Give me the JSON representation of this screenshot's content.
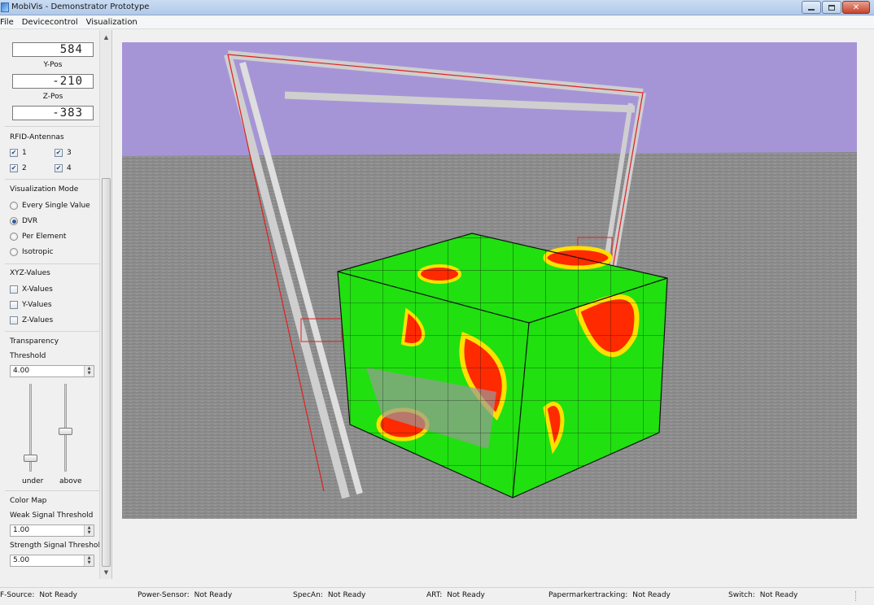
{
  "window": {
    "title": "MobiVis - Demonstrator Prototype",
    "controls": [
      "minimize",
      "maximize",
      "close"
    ],
    "close_glyph": "✕"
  },
  "menu": [
    "File",
    "Devicecontrol",
    "Visualization"
  ],
  "position": {
    "x_value": "584",
    "y_label": "Y-Pos",
    "y_value": "-210",
    "z_label": "Z-Pos",
    "z_value": "-383"
  },
  "rfid": {
    "title": "RFID-Antennas",
    "antennas": [
      {
        "label": "1",
        "checked": true
      },
      {
        "label": "3",
        "checked": true
      },
      {
        "label": "2",
        "checked": true
      },
      {
        "label": "4",
        "checked": true
      }
    ]
  },
  "vis_mode": {
    "title": "Visualization Mode",
    "options": [
      {
        "label": "Every Single  Value",
        "selected": false
      },
      {
        "label": "DVR",
        "selected": true
      },
      {
        "label": "Per Element",
        "selected": false
      },
      {
        "label": "Isotropic",
        "selected": false
      }
    ]
  },
  "xyz": {
    "title": "XYZ-Values",
    "items": [
      {
        "label": "X-Values",
        "checked": false
      },
      {
        "label": "Y-Values",
        "checked": false
      },
      {
        "label": "Z-Values",
        "checked": false
      }
    ]
  },
  "transparency": {
    "title": "Transparency",
    "threshold_label": "Threshold",
    "threshold_value": "4.00",
    "under_label": "under",
    "above_label": "above",
    "under_level": 0.12,
    "above_level": 0.45
  },
  "colormap": {
    "title": "Color Map",
    "weak_label": "Weak Signal Threshold",
    "weak_value": "1.00",
    "strong_label": "Strength Signal Threshold",
    "strong_value": "5.00"
  },
  "status": [
    {
      "name": "F-Source:",
      "value": "Not Ready"
    },
    {
      "name": "Power-Sensor:",
      "value": "Not Ready"
    },
    {
      "name": "SpecAn:",
      "value": "Not Ready"
    },
    {
      "name": "ART:",
      "value": "Not Ready"
    },
    {
      "name": "Papermarkertracking:",
      "value": "Not Ready"
    },
    {
      "name": "Switch:",
      "value": "Not Ready"
    }
  ],
  "colors": {
    "sky": "#a695d6",
    "ground": "#8d8d8d",
    "signal_strong": "#ff2a00",
    "signal_mid": "#ffe100",
    "signal_weak": "#20e010",
    "truss_outline": "#e02020"
  },
  "icons": [
    "app-icon",
    "scroll-up-icon",
    "scroll-down-icon",
    "spin-arrows-icon",
    "size-grip-icon"
  ]
}
